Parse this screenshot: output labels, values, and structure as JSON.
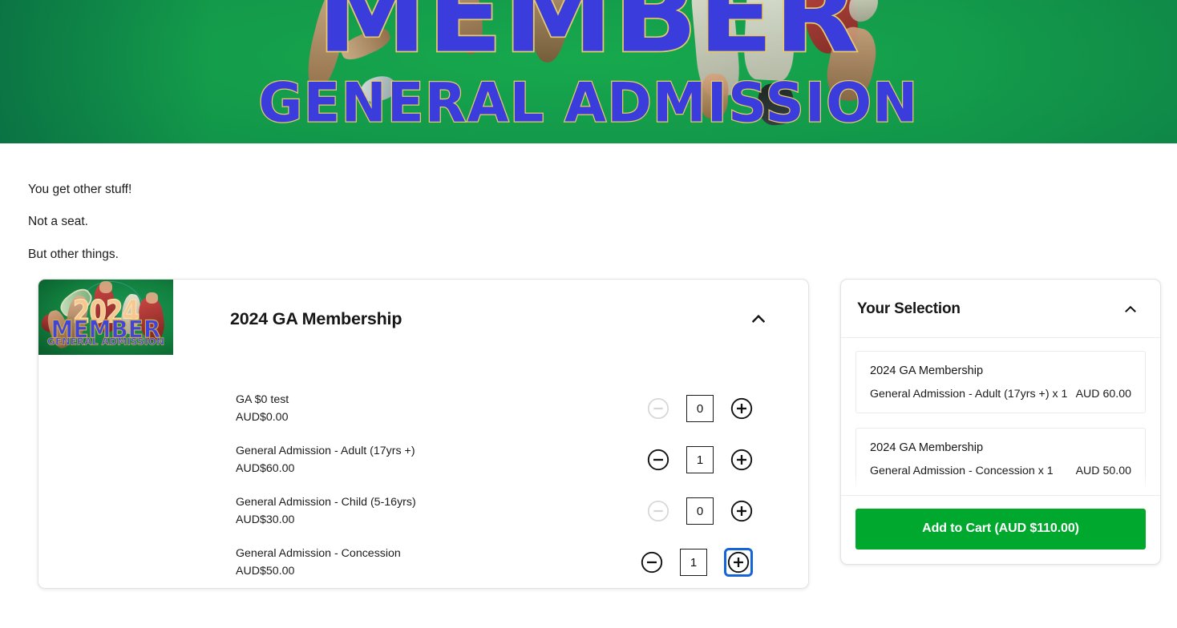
{
  "hero": {
    "wordmark_main": "MEMBER",
    "wordmark_sub": "GENERAL ADMISSION",
    "background_color": "#13a04d",
    "text_color": "#3a3ddb",
    "outline_color": "#e8c96a"
  },
  "intro": {
    "line1": "You get other stuff!",
    "line2": "Not a seat.",
    "line3": "But other things."
  },
  "product": {
    "title": "2024 GA Membership",
    "collapse_icon": "chevron-up-icon",
    "thumbnail": {
      "year": "2024",
      "member": "MEMBER",
      "subtitle": "GENERAL ADMISSION"
    },
    "minus_icon": "minus-circle-icon",
    "plus_icon": "plus-circle-icon",
    "tickets": [
      {
        "name": "GA $0 test",
        "price": "AUD$0.00",
        "quantity": "0",
        "minus_enabled": false,
        "plus_focused": false
      },
      {
        "name": "General Admission - Adult (17yrs +)",
        "price": "AUD$60.00",
        "quantity": "1",
        "minus_enabled": true,
        "plus_focused": false
      },
      {
        "name": "General Admission - Child (5-16yrs)",
        "price": "AUD$30.00",
        "quantity": "0",
        "minus_enabled": false,
        "plus_focused": false
      },
      {
        "name": "General Admission - Concession",
        "price": "AUD$50.00",
        "quantity": "1",
        "minus_enabled": true,
        "plus_focused": true
      }
    ]
  },
  "selection": {
    "title": "Your Selection",
    "collapse_icon": "chevron-up-icon",
    "items": [
      {
        "title": "2024 GA Membership",
        "description": "General Admission - Adult (17yrs +) x 1",
        "amount": "AUD 60.00"
      },
      {
        "title": "2024 GA Membership",
        "description": "General Admission - Concession x 1",
        "amount": "AUD 50.00"
      }
    ],
    "add_to_cart_label": "Add to Cart (AUD $110.00)",
    "add_to_cart_color": "#00a82d"
  }
}
